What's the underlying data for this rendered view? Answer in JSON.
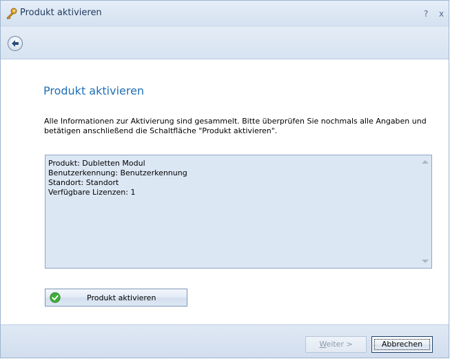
{
  "window": {
    "title": "Produkt aktivieren",
    "help_glyph": "?",
    "close_glyph": "x"
  },
  "toolbar": {
    "back_icon": "back-arrow-icon"
  },
  "content": {
    "heading": "Produkt aktivieren",
    "instructions": "Alle Informationen zur Aktivierung sind gesammelt. Bitte überprüfen Sie nochmals alle Angaben und betätigen anschließend die Schaltfläche \"Produkt aktivieren\".",
    "summary_lines": [
      "Produkt: Dubletten Modul",
      "Benutzerkennung: Benutzerkennung",
      "Standort: Standort",
      "Verfügbare Lizenzen: 1"
    ],
    "activate_button": "Produkt aktivieren"
  },
  "footer": {
    "next_prefix": "W",
    "next_rest": "eiter >",
    "cancel_label": "Abbrechen"
  },
  "colors": {
    "accent": "#1f6fb4",
    "summary_bg": "#dce7f4",
    "title_bg": "#dbe6f3"
  }
}
